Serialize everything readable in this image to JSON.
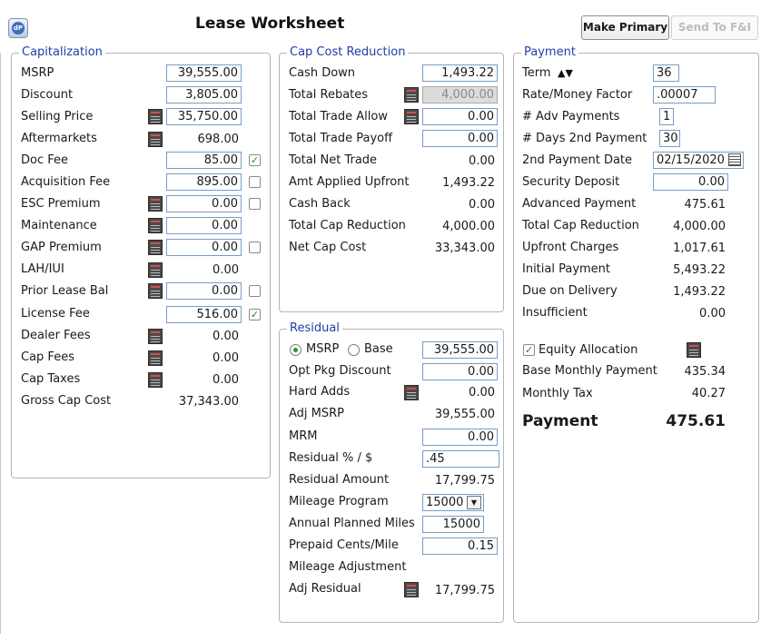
{
  "app_icon_text": "dP",
  "title": "Lease Worksheet",
  "toolbar": {
    "make_primary": "Make Primary",
    "send_to_fi": "Send To F&I"
  },
  "capitalization": {
    "legend": "Capitalization",
    "msrp": {
      "label": "MSRP",
      "value": "39,555.00"
    },
    "discount": {
      "label": "Discount",
      "value": "3,805.00"
    },
    "selling_price": {
      "label": "Selling Price",
      "value": "35,750.00"
    },
    "aftermarkets": {
      "label": "Aftermarkets",
      "value": "698.00"
    },
    "doc_fee": {
      "label": "Doc Fee",
      "value": "85.00",
      "checked": true
    },
    "acquisition_fee": {
      "label": "Acquisition Fee",
      "value": "895.00",
      "checked": false
    },
    "esc_premium": {
      "label": "ESC Premium",
      "value": "0.00",
      "checked": false
    },
    "maintenance": {
      "label": "Maintenance",
      "value": "0.00"
    },
    "gap_premium": {
      "label": "GAP Premium",
      "value": "0.00",
      "checked": false
    },
    "lah_iui": {
      "label": "LAH/IUI",
      "value": "0.00"
    },
    "prior_lease_bal": {
      "label": "Prior Lease Bal",
      "value": "0.00",
      "checked": false
    },
    "license_fee": {
      "label": "License Fee",
      "value": "516.00",
      "checked": true
    },
    "dealer_fees": {
      "label": "Dealer Fees",
      "value": "0.00"
    },
    "cap_fees": {
      "label": "Cap Fees",
      "value": "0.00"
    },
    "cap_taxes": {
      "label": "Cap Taxes",
      "value": "0.00"
    },
    "gross_cap_cost": {
      "label": "Gross Cap Cost",
      "value": "37,343.00"
    }
  },
  "cap_cost_reduction": {
    "legend": "Cap Cost Reduction",
    "cash_down": {
      "label": "Cash Down",
      "value": "1,493.22"
    },
    "total_rebates": {
      "label": "Total Rebates",
      "value": "4,000.00"
    },
    "total_trade_allow": {
      "label": "Total Trade Allow",
      "value": "0.00"
    },
    "total_trade_payoff": {
      "label": "Total Trade Payoff",
      "value": "0.00"
    },
    "total_net_trade": {
      "label": "Total Net Trade",
      "value": "0.00"
    },
    "amt_applied_upfront": {
      "label": "Amt Applied Upfront",
      "value": "1,493.22"
    },
    "cash_back": {
      "label": "Cash Back",
      "value": "0.00"
    },
    "total_cap_reduction": {
      "label": "Total Cap Reduction",
      "value": "4,000.00"
    },
    "net_cap_cost": {
      "label": "Net Cap Cost",
      "value": "33,343.00"
    }
  },
  "residual": {
    "legend": "Residual",
    "msrp_option": "MSRP",
    "base_option": "Base",
    "msrp_value": "39,555.00",
    "opt_pkg_discount": {
      "label": "Opt Pkg Discount",
      "value": "0.00"
    },
    "hard_adds": {
      "label": "Hard Adds",
      "value": "0.00"
    },
    "adj_msrp": {
      "label": "Adj MSRP",
      "value": "39,555.00"
    },
    "mrm": {
      "label": "MRM",
      "value": "0.00"
    },
    "residual_pct": {
      "label": "Residual % / $",
      "value": ".45"
    },
    "residual_amount": {
      "label": "Residual Amount",
      "value": "17,799.75"
    },
    "mileage_program": {
      "label": "Mileage Program",
      "value": "15000"
    },
    "annual_planned_miles": {
      "label": "Annual Planned Miles",
      "value": "15000"
    },
    "prepaid_cents_mile": {
      "label": "Prepaid Cents/Mile",
      "value": "0.15"
    },
    "mileage_adjustment": {
      "label": "Mileage Adjustment"
    },
    "adj_residual": {
      "label": "Adj Residual",
      "value": "17,799.75"
    }
  },
  "payment": {
    "legend": "Payment",
    "term": {
      "label": "Term",
      "value": "36",
      "arrows": "▲▼"
    },
    "rate_money_factor": {
      "label": "Rate/Money Factor",
      "value": ".00007"
    },
    "adv_payments": {
      "label": "# Adv Payments",
      "value": "1"
    },
    "days_2nd_payment": {
      "label": "# Days 2nd Payment",
      "value": "30"
    },
    "second_payment_date": {
      "label": "2nd Payment Date",
      "value": "02/15/2020"
    },
    "security_deposit": {
      "label": "Security Deposit",
      "value": "0.00"
    },
    "advanced_payment": {
      "label": "Advanced Payment",
      "value": "475.61"
    },
    "total_cap_reduction": {
      "label": "Total Cap Reduction",
      "value": "4,000.00"
    },
    "upfront_charges": {
      "label": "Upfront Charges",
      "value": "1,017.61"
    },
    "initial_payment": {
      "label": "Initial Payment",
      "value": "5,493.22"
    },
    "due_on_delivery": {
      "label": "Due on Delivery",
      "value": "1,493.22"
    },
    "insufficient": {
      "label": "Insufficient",
      "value": "0.00"
    },
    "equity_allocation": {
      "label": "Equity Allocation",
      "checked": true
    },
    "base_monthly_payment": {
      "label": "Base Monthly Payment",
      "value": "435.34"
    },
    "monthly_tax": {
      "label": "Monthly Tax",
      "value": "40.27"
    },
    "payment_total": {
      "label": "Payment",
      "value": "475.61"
    }
  }
}
